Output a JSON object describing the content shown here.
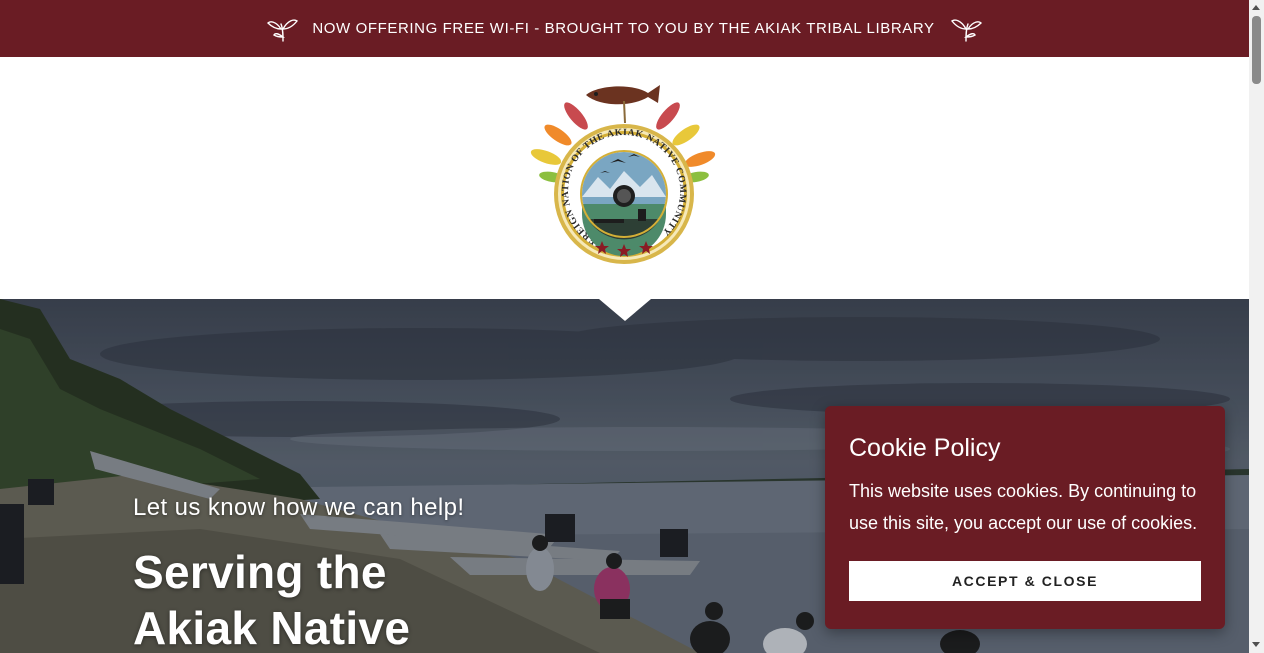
{
  "announcement": {
    "text": "NOW OFFERING FREE WI-FI - BROUGHT TO YOU BY THE AKIAK TRIBAL LIBRARY",
    "background": "#6a1c24",
    "icons": [
      "leaf-icon",
      "leaf-icon"
    ]
  },
  "logo": {
    "ring_text": "SOVEREIGN NATION OF THE AKIAK NATIVE COMMUNITY"
  },
  "hero": {
    "subtitle": "Let us know how we can help!",
    "title_line1": "Serving the",
    "title_line2": "Akiak Native"
  },
  "cookie": {
    "title": "Cookie Policy",
    "body": "This website uses cookies. By continuing to use this site, you accept our use of cookies.",
    "button_label": "ACCEPT & CLOSE",
    "background": "#6a1c24"
  },
  "colors": {
    "brand_maroon": "#6a1c24",
    "white": "#ffffff"
  }
}
